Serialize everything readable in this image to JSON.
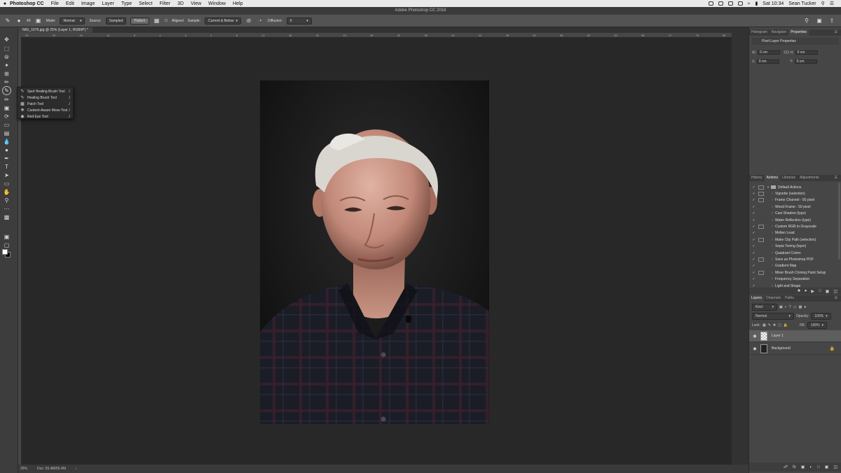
{
  "menubar": {
    "app_name": "Photoshop CC",
    "items": [
      "File",
      "Edit",
      "Image",
      "Layer",
      "Type",
      "Select",
      "Filter",
      "3D",
      "View",
      "Window",
      "Help"
    ],
    "clock": "Sat 10:34",
    "user": "Sean Tucker"
  },
  "window": {
    "title": "Adobe Photoshop CC 2018"
  },
  "options": {
    "brush_size": "40",
    "mode_label": "Mode:",
    "mode_value": "Normal",
    "source_label": "Source:",
    "sampled_label": "Sampled",
    "pattern_label": "Pattern",
    "aligned_label": "Aligned",
    "sample_label": "Sample:",
    "sample_value": "Current & Below",
    "diffusion_label": "Diffusion:",
    "diffusion_value": "5"
  },
  "document": {
    "tab_title": "IMG_1676.jpg @ 25% (Layer 1, RGB/8*) *"
  },
  "ruler": {
    "ticks": [
      "24",
      "20",
      "16",
      "12",
      "8",
      "4",
      "0",
      "4",
      "8",
      "12",
      "16",
      "20",
      "24",
      "28",
      "32",
      "36",
      "40",
      "44",
      "48",
      "52",
      "56",
      "60",
      "64",
      "68",
      "72",
      "76",
      "80"
    ]
  },
  "status": {
    "zoom": "25%",
    "doc_size": "Doc: 55.4M/55.4M"
  },
  "flyout": {
    "items": [
      {
        "label": "Spot Healing Brush Tool",
        "key": "J"
      },
      {
        "label": "Healing Brush Tool",
        "key": "J"
      },
      {
        "label": "Patch Tool",
        "key": "J"
      },
      {
        "label": "Content-Aware Move Tool",
        "key": "J"
      },
      {
        "label": "Red Eye Tool",
        "key": "J"
      }
    ]
  },
  "panels": {
    "top_tabs": [
      "Histogram",
      "Navigator",
      "Properties"
    ],
    "properties": {
      "title": "Pixel Layer Properties",
      "w_label": "W:",
      "w_value": "0 cm",
      "go_label": "GO",
      "h_label": "H:",
      "h_value": "0 cm",
      "x_label": "X:",
      "x_value": "0 cm",
      "y_label": "Y:",
      "y_value": "0 cm"
    },
    "mid_tabs": [
      "History",
      "Actions",
      "Libraries",
      "Adjustments"
    ],
    "actions": [
      "Default Actions",
      "Vignette (selection)",
      "Frame Channel - 50 pixel",
      "Wood Frame - 50 pixel",
      "Cast Shadow (type)",
      "Water Reflection (type)",
      "Custom RGB to Grayscale",
      "Molten Lead",
      "Make Clip Path (selection)",
      "Sepia Toning (layer)",
      "Quadrant Colors",
      "Save as Photoshop PDF",
      "Gradient Map",
      "Mixer Brush Cloning Paint Setup",
      "Frequency Separation",
      "Light and Shape"
    ],
    "layer_tabs": [
      "Layers",
      "Channels",
      "Paths"
    ],
    "layers": {
      "kind_label": "Kind",
      "blend_mode": "Normal",
      "opacity_label": "Opacity:",
      "opacity_value": "100%",
      "lock_label": "Lock:",
      "fill_label": "Fill:",
      "fill_value": "100%",
      "items": [
        "Layer 1",
        "Background"
      ]
    }
  },
  "colors": {
    "foreground": "#ffffff",
    "background": "#000000"
  }
}
